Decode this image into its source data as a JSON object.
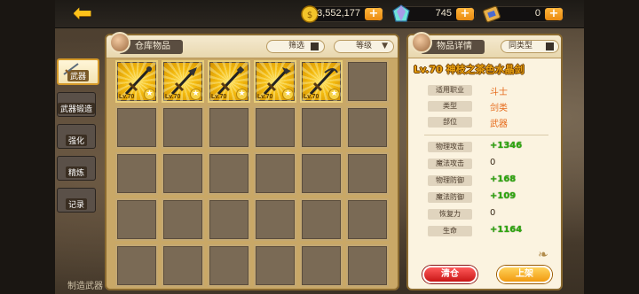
{
  "topbar": {
    "gold": "3,552,177",
    "gems": "745",
    "tickets": "0",
    "plus_label": "+"
  },
  "categories": [
    {
      "label": "武器"
    },
    {
      "label": "武器锻造"
    },
    {
      "label": "强化"
    },
    {
      "label": "精炼"
    },
    {
      "label": "记录"
    }
  ],
  "bottom_label": "制造武器",
  "storage": {
    "title": "仓库物品",
    "filter_label": "筛选",
    "sort_label": "等级",
    "items": [
      {
        "level": "Lv.70"
      },
      {
        "level": "Lv.70"
      },
      {
        "level": "Lv.70"
      },
      {
        "level": "Lv.70"
      },
      {
        "level": "Lv.70"
      }
    ]
  },
  "detail": {
    "title": "物品详情",
    "compare_label": "同类型",
    "item_name": "Lv.70 神枝之茶色水晶剑",
    "attributes": [
      {
        "label": "适用职业",
        "value": "斗士",
        "style": "orange"
      },
      {
        "label": "类型",
        "value": "剑类",
        "style": "orange"
      },
      {
        "label": "部位",
        "value": "武器",
        "style": "orange"
      }
    ],
    "stats": [
      {
        "label": "物理攻击",
        "value": "+1346",
        "style": "green"
      },
      {
        "label": "魔法攻击",
        "value": "0",
        "style": "dark"
      },
      {
        "label": "物理防御",
        "value": "+168",
        "style": "green"
      },
      {
        "label": "魔法防御",
        "value": "+109",
        "style": "green"
      },
      {
        "label": "恢复力",
        "value": "0",
        "style": "dark"
      },
      {
        "label": "生命",
        "value": "+1164",
        "style": "green"
      }
    ],
    "warehouse_button": "清仓",
    "list_button": "上架"
  },
  "colors": {
    "panel_bg": "#c9a867",
    "gold_item_bg": "#f3b90e",
    "accent_orange": "#e66a1a",
    "stat_green": "#2fa70e"
  }
}
